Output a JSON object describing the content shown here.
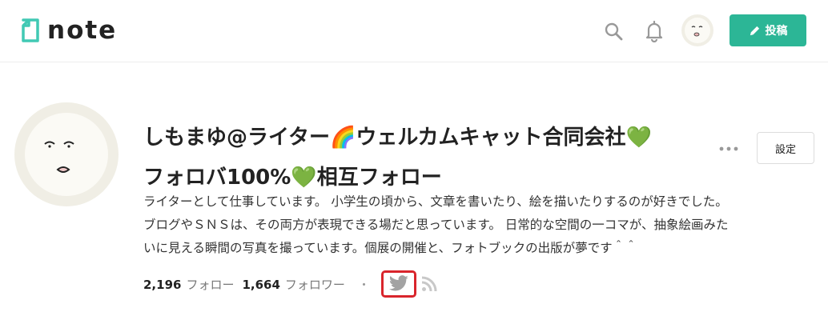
{
  "header": {
    "logo_text": "note",
    "post_button_label": "投稿",
    "icons": [
      "search-icon",
      "bell-icon",
      "user-avatar",
      "pencil-icon"
    ]
  },
  "profile": {
    "name_line1": "しもまゆ@ライター🌈ウェルカムキャット合同会社💚",
    "name_line2": "フォロバ100%💚相互フォロー",
    "settings_label": "設定",
    "bio": "ライターとして仕事しています。 小学生の頃から、文章を書いたり、絵を描いたりするのが好きでした。\nブログやＳＮＳは、その両方が表現できる場だと思っています。 日常的な空間の一コマが、抽象絵画みた\nいに見える瞬間の写真を撮っています。個展の開催と、フォトブックの出版が夢です＾＾",
    "following_count": "2,196",
    "following_label": "フォロー",
    "followers_count": "1,664",
    "followers_label": "フォロワー",
    "separator": "・",
    "social_icons": [
      "twitter-icon",
      "rss-icon"
    ]
  },
  "colors": {
    "brand": "#2cb696",
    "highlight": "#d9252c",
    "text": "#222222",
    "muted": "#777777"
  }
}
